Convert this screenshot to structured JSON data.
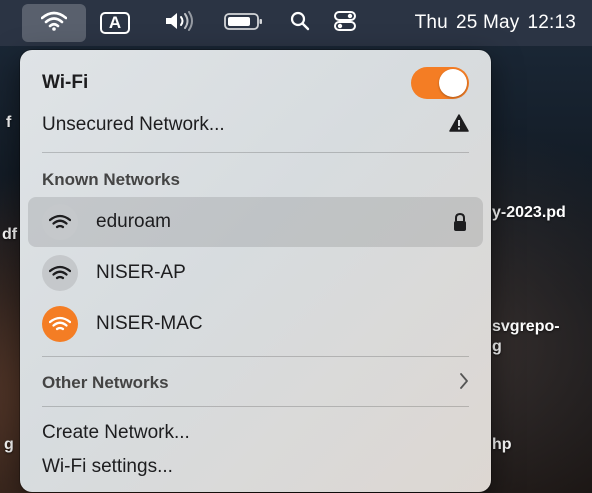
{
  "menubar": {
    "input_label": "A",
    "clock": {
      "day": "Thu",
      "date": "25 May",
      "time": "12:13"
    }
  },
  "desktop": {
    "labels": [
      "f",
      "df",
      "y-2023.pd",
      "svgrepo-",
      "g",
      "g",
      "hp"
    ]
  },
  "panel": {
    "title": "Wi-Fi",
    "wifi_enabled": true,
    "unsecured_label": "Unsecured Network...",
    "known_header": "Known Networks",
    "known_networks": [
      {
        "name": "eduroam",
        "locked": true,
        "selected": true,
        "connected": false
      },
      {
        "name": "NISER-AP",
        "locked": false,
        "selected": false,
        "connected": false
      },
      {
        "name": "NISER-MAC",
        "locked": false,
        "selected": false,
        "connected": true
      }
    ],
    "other_header": "Other Networks",
    "create_label": "Create Network...",
    "settings_label": "Wi-Fi settings..."
  },
  "colors": {
    "accent": "#f47d24",
    "menubar": "#2b3444"
  },
  "icons": [
    "wifi-icon",
    "keyboard-input-icon",
    "volume-icon",
    "battery-icon",
    "search-icon",
    "control-center-icon",
    "warning-icon",
    "lock-icon",
    "chevron-right-icon"
  ]
}
